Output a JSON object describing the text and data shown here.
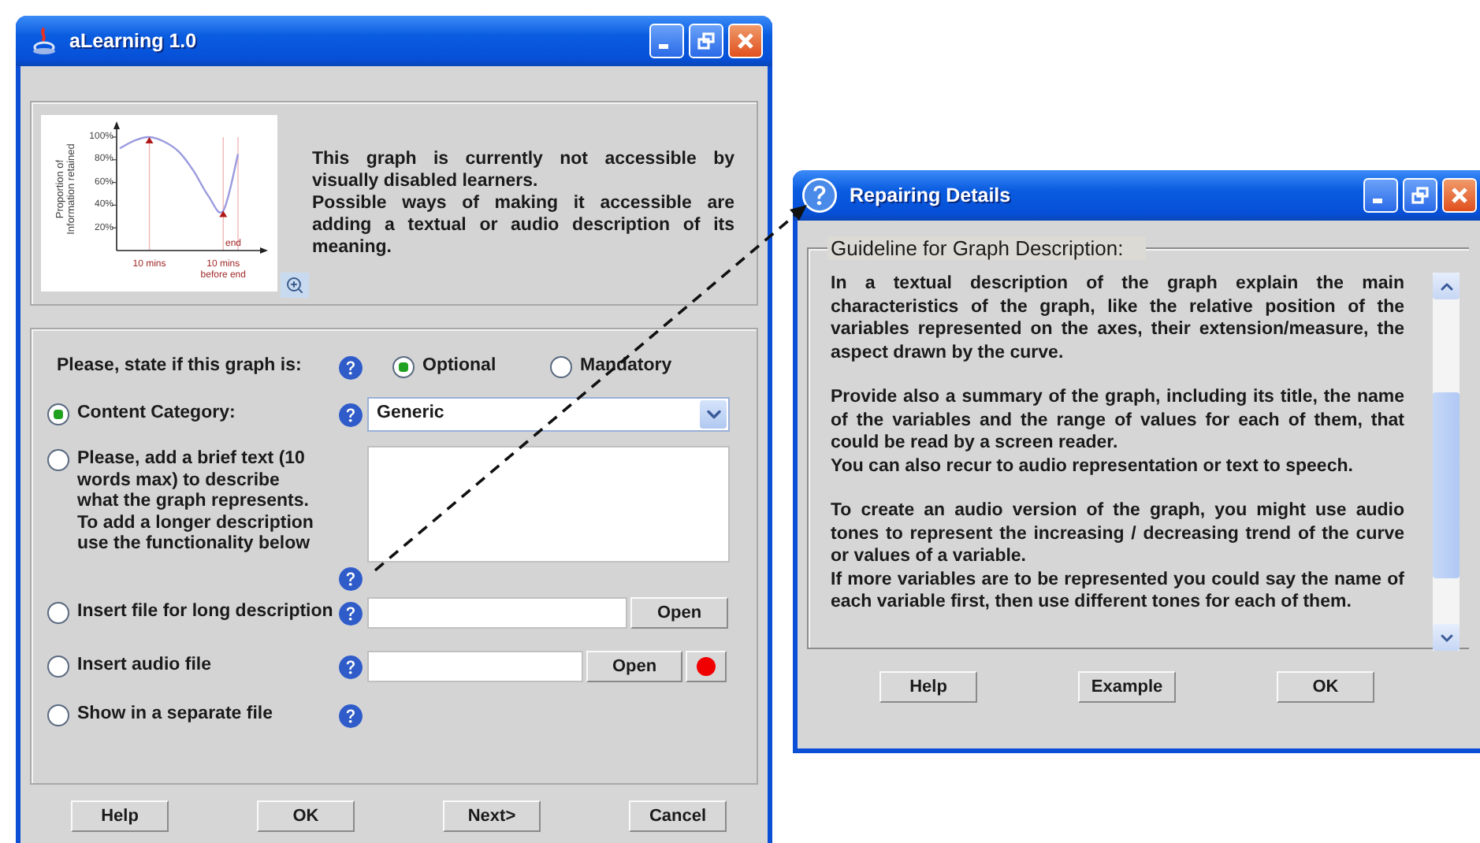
{
  "main_window": {
    "title": "aLearning 1.0",
    "graph": {
      "chart_data": {
        "type": "line",
        "ylabel": "Proportion of Information retained",
        "categories": [
          null,
          null,
          "10 mins",
          null,
          null,
          null,
          null,
          "10 mins before end",
          "end"
        ],
        "series": [
          {
            "color": "#9a9ae0",
            "values": [
              90,
              97,
              100,
              96,
              87,
              70,
              48,
              35,
              85
            ]
          }
        ],
        "ylim": [
          0,
          100
        ],
        "grid": true,
        "yticks": [
          {
            "value": 20,
            "label": "20%"
          },
          {
            "value": 40,
            "label": "40%"
          },
          {
            "value": 60,
            "label": "60%"
          },
          {
            "value": 80,
            "label": "80%"
          },
          {
            "value": 100,
            "label": "100%"
          }
        ]
      }
    },
    "notice": [
      "This graph is currently not accessible by visually disabled learners.",
      "Possible ways of making it accessible are adding a textual or audio description of its meaning."
    ],
    "requirement": {
      "question": "Please, state if this graph is:",
      "options": [
        {
          "label": "Optional",
          "selected": true
        },
        {
          "label": "Mandatory",
          "selected": false
        }
      ]
    },
    "options": [
      {
        "kind": "dropdown",
        "label": "Content Category:",
        "selected": true,
        "value": "Generic"
      },
      {
        "kind": "textarea",
        "label": "Please, add a brief text (10 words max) to describe what the graph represents. To add a longer description use the functionality below",
        "selected": false
      },
      {
        "kind": "file",
        "label": "Insert file for long description",
        "selected": false,
        "button": "Open"
      },
      {
        "kind": "audio",
        "label": "Insert audio file",
        "selected": false,
        "button": "Open"
      },
      {
        "kind": "plain",
        "label": "Show in a separate file",
        "selected": false
      }
    ],
    "buttons": [
      "Help",
      "OK",
      "Next>",
      "Cancel"
    ]
  },
  "dialog": {
    "title": "Repairing Details",
    "group_title": "Guideline for Graph Description:",
    "paragraphs": [
      [
        "In a textual description of the graph explain the main characteristics of the graph, like the relative position of the variables represented on the axes, their extension/measure, the aspect drawn by the curve."
      ],
      [
        "Provide also a summary of the graph, including its title, the name of the variables and the range of values for each of them, that could be read by a screen reader.",
        "You can also recur to audio representation or text to speech."
      ],
      [
        "To create an audio version of the graph, you might use audio tones to represent the increasing / decreasing trend of the curve or values of a variable.",
        "If more variables are to be represented you could say the name of each variable first, then use different tones for  each of them."
      ]
    ],
    "buttons": [
      "Help",
      "Example",
      "OK"
    ]
  }
}
